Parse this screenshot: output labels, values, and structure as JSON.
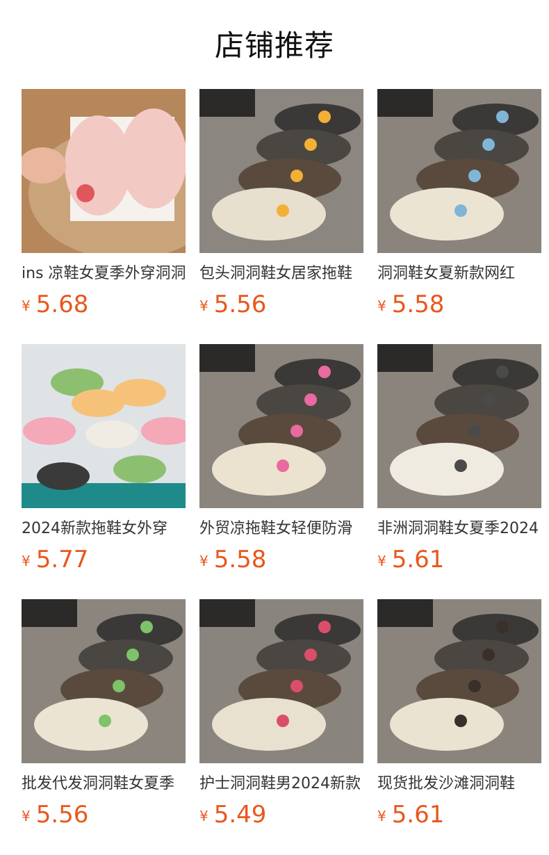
{
  "header": {
    "title": "店铺推荐"
  },
  "products": [
    {
      "title": "ins 凉鞋女夏季外穿洞洞鞋",
      "currency": "¥",
      "price": "5.68",
      "image": "pink-clogs-strawberry-charm",
      "bg": "#b5875a",
      "shoe": "#f3c9c4",
      "accent": "#e0575b"
    },
    {
      "title": "包头洞洞鞋女居家拖鞋",
      "currency": "¥",
      "price": "5.56",
      "image": "clogs-fruit-charms",
      "bg": "#8c8680",
      "shoe": "#e8e0cf",
      "accent": "#f2b134"
    },
    {
      "title": "洞洞鞋女夏新款网红",
      "currency": "¥",
      "price": "5.58",
      "image": "clogs-bear-charms",
      "bg": "#8a847c",
      "shoe": "#ece4d3",
      "accent": "#7fb6d6"
    },
    {
      "title": "2024新款拖鞋女外穿",
      "currency": "¥",
      "price": "5.77",
      "image": "colorful-slides-pile",
      "bg": "#dfe3e6",
      "shoe": "#f4a8b8",
      "accent": "#8cc070"
    },
    {
      "title": "外贸凉拖鞋女轻便防滑",
      "currency": "¥",
      "price": "5.58",
      "image": "clogs-pink-bunny-charms",
      "bg": "#8b857e",
      "shoe": "#ebe3d0",
      "accent": "#e86aa0"
    },
    {
      "title": "非洲洞洞鞋女夏季2024",
      "currency": "¥",
      "price": "5.61",
      "image": "plain-clogs",
      "bg": "#8a847d",
      "shoe": "#f0ebe0",
      "accent": "#4a4a4a"
    },
    {
      "title": "批发代发洞洞鞋女夏季",
      "currency": "¥",
      "price": "5.56",
      "image": "clogs-panda-charms",
      "bg": "#8b857d",
      "shoe": "#ebe4d3",
      "accent": "#7ec26a"
    },
    {
      "title": "护士洞洞鞋男2024新款",
      "currency": "¥",
      "price": "5.49",
      "image": "clogs-rabbit-charms",
      "bg": "#8a847e",
      "shoe": "#e9e1cf",
      "accent": "#d94f6a"
    },
    {
      "title": "现货批发沙滩洞洞鞋",
      "currency": "¥",
      "price": "5.61",
      "image": "clogs-bear-piano-charms",
      "bg": "#8a847d",
      "shoe": "#ebe3d1",
      "accent": "#3a2f2a"
    }
  ]
}
